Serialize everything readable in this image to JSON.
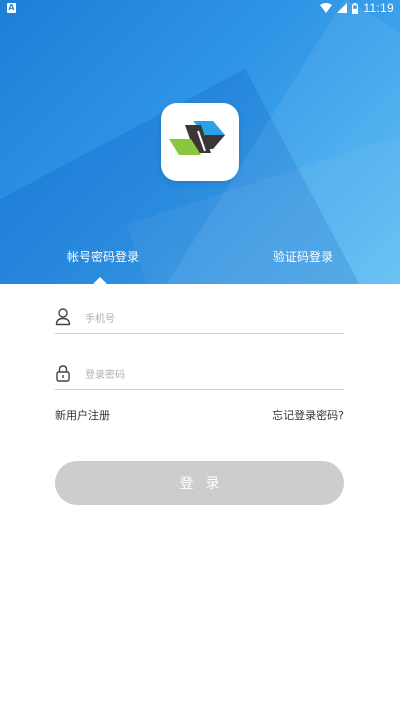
{
  "status_bar": {
    "left_icon_text": "A",
    "time": "11:19",
    "icons": [
      "wifi-icon",
      "cellular-signal-icon",
      "battery-icon"
    ]
  },
  "app": {
    "logo": "app-logo-icon"
  },
  "tabs": [
    {
      "label": "帐号密码登录",
      "active": true
    },
    {
      "label": "验证码登录",
      "active": false
    }
  ],
  "form": {
    "phone_placeholder": "手机号",
    "password_placeholder": "登录密码",
    "register_label": "新用户注册",
    "forgot_label": "忘记登录密码?",
    "login_label": "登录"
  },
  "colors": {
    "header_gradient_start": "#1d7fd6",
    "header_gradient_end": "#55bcf4",
    "button_disabled": "#cdcdcd",
    "logo_green": "#8cc63f",
    "logo_blue": "#29a3e6",
    "logo_dark": "#3d3535"
  }
}
